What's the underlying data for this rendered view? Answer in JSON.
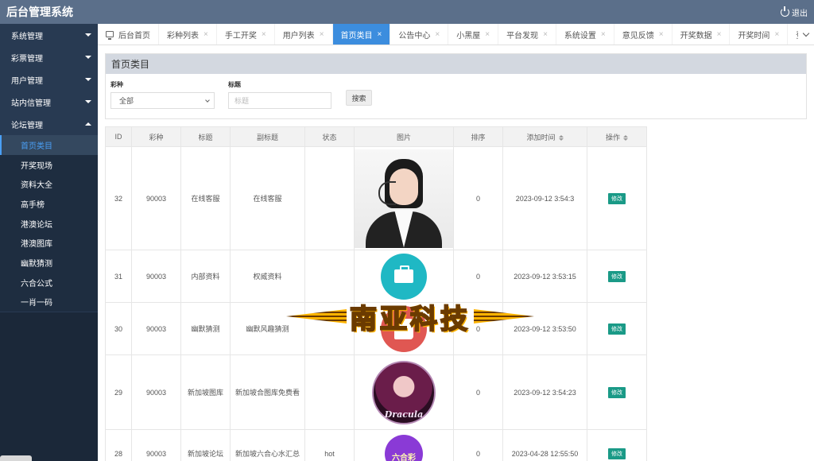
{
  "app": {
    "title": "后台管理系统",
    "logout_label": "退出"
  },
  "sidebar": {
    "groups": [
      {
        "label": "系统管理"
      },
      {
        "label": "彩票管理"
      },
      {
        "label": "用户管理"
      },
      {
        "label": "站内信管理"
      },
      {
        "label": "论坛管理"
      }
    ],
    "forum_items": [
      {
        "label": "首页类目"
      },
      {
        "label": "开奖现场"
      },
      {
        "label": "资料大全"
      },
      {
        "label": "高手榜"
      },
      {
        "label": "港澳论坛"
      },
      {
        "label": "港澳图库"
      },
      {
        "label": "幽默猜测"
      },
      {
        "label": "六合公式"
      },
      {
        "label": "一肖一码"
      }
    ],
    "active_item": "首页类目"
  },
  "tabs": [
    {
      "label": "后台首页",
      "closable": false
    },
    {
      "label": "彩种列表",
      "closable": true
    },
    {
      "label": "手工开奖",
      "closable": true
    },
    {
      "label": "用户列表",
      "closable": true
    },
    {
      "label": "首页类目",
      "closable": true,
      "active": true
    },
    {
      "label": "公告中心",
      "closable": true
    },
    {
      "label": "小黑屋",
      "closable": true
    },
    {
      "label": "平台发现",
      "closable": true
    },
    {
      "label": "系统设置",
      "closable": true
    },
    {
      "label": "意见反馈",
      "closable": true
    },
    {
      "label": "开奖数据",
      "closable": true
    },
    {
      "label": "开奖时间",
      "closable": true
    },
    {
      "label": "登录",
      "closable": false
    }
  ],
  "panel": {
    "title": "首页类目",
    "filter_lottery_label": "彩种",
    "filter_lottery_value": "全部",
    "filter_title_label": "标题",
    "filter_title_placeholder": "标题",
    "search_label": "搜索"
  },
  "table": {
    "headers": [
      "ID",
      "彩种",
      "标题",
      "副标题",
      "状态",
      "图片",
      "排序",
      "添加时间",
      "操作"
    ],
    "edit_label": "修改",
    "rows": [
      {
        "id": "32",
        "lottery": "90003",
        "title": "在线客服",
        "subtitle": "在线客服",
        "status": "",
        "image": "customer-service-photo",
        "sort": "0",
        "added": "2023-09-12 3:54:3"
      },
      {
        "id": "31",
        "lottery": "90003",
        "title": "内部资料",
        "subtitle": "权威资料",
        "status": "",
        "image": "briefcase-icon",
        "sort": "0",
        "added": "2023-09-12 3:53:15"
      },
      {
        "id": "30",
        "lottery": "90003",
        "title": "幽默猜测",
        "subtitle": "幽默风趣猜测",
        "status": "",
        "image": "book-icon",
        "sort": "0",
        "added": "2023-09-12 3:53:50"
      },
      {
        "id": "29",
        "lottery": "90003",
        "title": "新加坡图库",
        "subtitle": "新加坡合图库免费看",
        "status": "",
        "image": "dracula-logo",
        "image_text": "Dracula",
        "sort": "0",
        "added": "2023-09-12 3:54:23"
      },
      {
        "id": "28",
        "lottery": "90003",
        "title": "新加坡论坛",
        "subtitle": "新加坡六合心水汇总",
        "status": "hot",
        "image": "liuhecai-logo",
        "image_text": "六合彩",
        "sort": "0",
        "added": "2023-04-28 12:55:50"
      }
    ]
  },
  "watermark": {
    "text": "南亚科技"
  },
  "colors": {
    "topbar": "#5b6f8a",
    "sidebar": "#283a52",
    "active_tab": "#3c8dde",
    "edit_button": "#1a9a87"
  }
}
